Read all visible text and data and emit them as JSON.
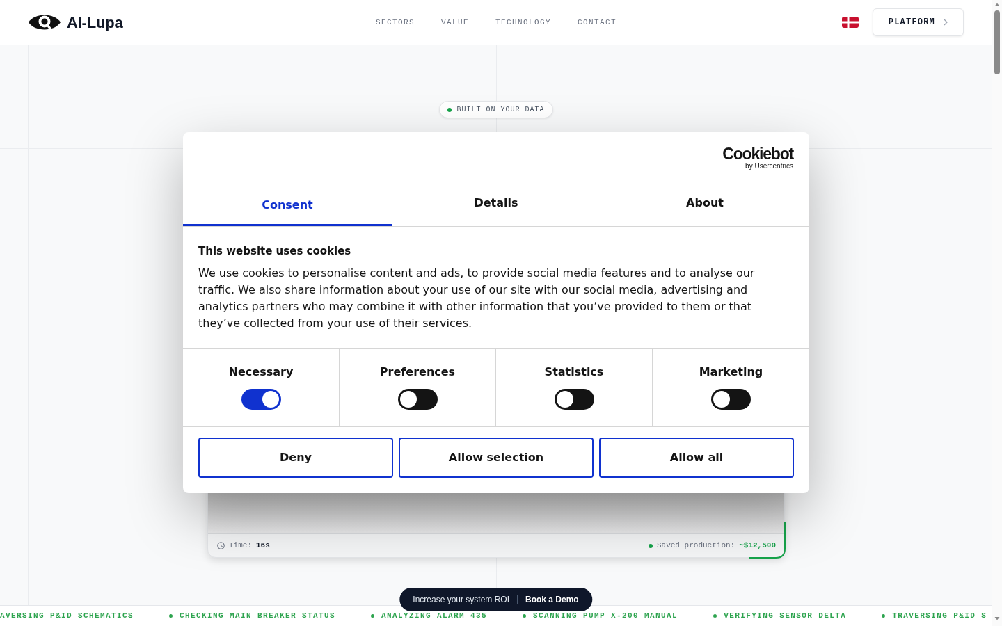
{
  "header": {
    "brand": "AI-Lupa",
    "nav": [
      "SECTORS",
      "VALUE",
      "TECHNOLOGY",
      "CONTACT"
    ],
    "platform_button": "PLATFORM"
  },
  "hero": {
    "badge": "BUILT ON YOUR DATA"
  },
  "demo_card": {
    "time_label": "Time:",
    "time_value": "16s",
    "saved_label": "Saved production:",
    "saved_value": "~$12,500"
  },
  "cookie_dialog": {
    "logo": {
      "wordmark": "Cookiebot",
      "byline": "by Usercentrics"
    },
    "tabs": [
      {
        "label": "Consent",
        "selected": true
      },
      {
        "label": "Details",
        "selected": false
      },
      {
        "label": "About",
        "selected": false
      }
    ],
    "title": "This website uses cookies",
    "body": "We use cookies to personalise content and ads, to provide social media features and to analyse our traffic. We also share information about your use of our site with our social media, advertising and analytics partners who may combine it with other information that you’ve provided to them or that they’ve collected from your use of their services.",
    "categories": [
      {
        "label": "Necessary",
        "on": true
      },
      {
        "label": "Preferences",
        "on": false
      },
      {
        "label": "Statistics",
        "on": false
      },
      {
        "label": "Marketing",
        "on": false
      }
    ],
    "buttons": [
      "Deny",
      "Allow selection",
      "Allow all"
    ]
  },
  "cta_bar": {
    "text": "Increase your system ROI",
    "button": "Book a Demo"
  },
  "ticker": [
    {
      "text": "AVERSING P&ID SCHEMATICS",
      "bullet": false
    },
    {
      "text": "CHECKING MAIN BREAKER STATUS",
      "bullet": true
    },
    {
      "text": "ANALYZING ALARM 435",
      "bullet": true
    },
    {
      "text": "SCANNING PUMP X-200 MANUAL",
      "bullet": true
    },
    {
      "text": "VERIFYING SENSOR DELTA",
      "bullet": true
    },
    {
      "text": "TRAVERSING P&ID S",
      "bullet": true
    }
  ]
}
